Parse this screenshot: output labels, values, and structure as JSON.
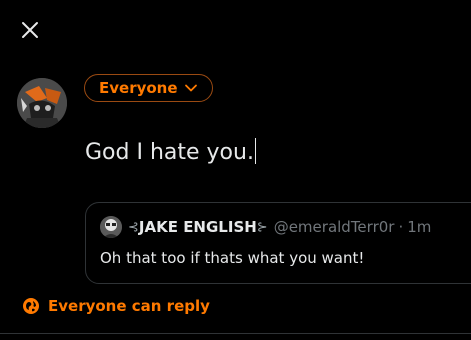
{
  "icons": {
    "close": "close-icon",
    "audience_chevron": "chevron-down-icon",
    "reply_globe": "globe-icon",
    "avatar": "avatar",
    "name_symbol": "leaf-symbol"
  },
  "colors": {
    "accent": "#ff7a00",
    "background": "#000000",
    "text": "#e7e9ea",
    "muted": "#71767b",
    "border": "#2f3336"
  },
  "composer": {
    "audience_label": "Everyone",
    "text": "God I hate you."
  },
  "quoted_post": {
    "name": "JAKE ENGLISH",
    "name_prefix": "⊰",
    "name_suffix": "⊱",
    "handle": "@emeraldTerr0r",
    "separator": "·",
    "time": "1m",
    "body": "Oh that too if thats what you want!"
  },
  "reply_setting": {
    "label": "Everyone can reply"
  }
}
